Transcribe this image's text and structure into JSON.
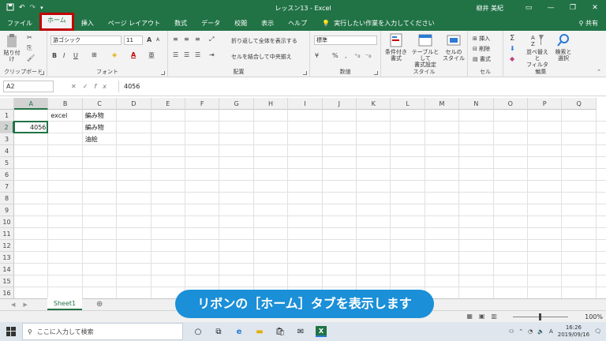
{
  "window": {
    "title": "レッスン13  -  Excel",
    "user": "柳井 美紀",
    "undo_icon": "undo-icon",
    "redo_icon": "redo-icon",
    "buttons": [
      "ribbon-display-icon",
      "minimize-icon",
      "maximize-icon",
      "close-icon"
    ]
  },
  "tabs": [
    {
      "label": "ファイル"
    },
    {
      "label": "ホーム",
      "active": true
    },
    {
      "label": "挿入"
    },
    {
      "label": "ページ レイアウト"
    },
    {
      "label": "数式"
    },
    {
      "label": "データ"
    },
    {
      "label": "校閲"
    },
    {
      "label": "表示"
    },
    {
      "label": "ヘルプ"
    }
  ],
  "tell_me": "実行したい作業を入力してください",
  "share": "共有",
  "ribbon": {
    "clipboard": {
      "paste": "貼り付け",
      "label": "クリップボード"
    },
    "font": {
      "name": "游ゴシック",
      "size": "11",
      "label": "フォント",
      "bold": "B",
      "italic": "I",
      "underline": "U",
      "grow": "A",
      "shrink": "A",
      "font_color": "A"
    },
    "alignment": {
      "wrap": "折り返して全体を表示する",
      "merge": "セルを結合して中央揃え",
      "label": "配置"
    },
    "number": {
      "format": "標準",
      "percent": "%",
      "comma": ",",
      "label": "数値"
    },
    "styles": {
      "conditional": [
        "条件付き",
        "書式"
      ],
      "table": [
        "テーブルとして",
        "書式設定"
      ],
      "cell": [
        "セルの",
        "スタイル"
      ],
      "label": "スタイル"
    },
    "cells": {
      "insert": "挿入",
      "delete": "削除",
      "format": "書式",
      "label": "セル"
    },
    "editing": {
      "sort": [
        "並べ替えと",
        "フィルター"
      ],
      "find": [
        "検索と",
        "選択"
      ],
      "label": "編集"
    }
  },
  "formula_bar": {
    "name_box": "A2",
    "fx": "fx",
    "value": "4056"
  },
  "grid": {
    "columns": [
      "A",
      "B",
      "C",
      "D",
      "E",
      "F",
      "G",
      "H",
      "I",
      "J",
      "K",
      "L",
      "M",
      "N",
      "O",
      "P",
      "Q"
    ],
    "rows": [
      "1",
      "2",
      "3",
      "4",
      "5",
      "6",
      "7",
      "8",
      "9",
      "10",
      "11",
      "12",
      "13",
      "14",
      "15",
      "16"
    ],
    "cells": {
      "B1": "excel",
      "C1": "編み物",
      "A2": "4056",
      "C2": "編み物",
      "C3": "油絵"
    },
    "active_cell": "A2"
  },
  "sheet": {
    "name": "Sheet1",
    "add": "⊕"
  },
  "status": {
    "zoom": "100%"
  },
  "caption": "リボンの［ホーム］タブを表示します",
  "taskbar": {
    "search_placeholder": "ここに入力して検索",
    "time": "16:26",
    "date": "2019/09/16",
    "ime": "A"
  }
}
